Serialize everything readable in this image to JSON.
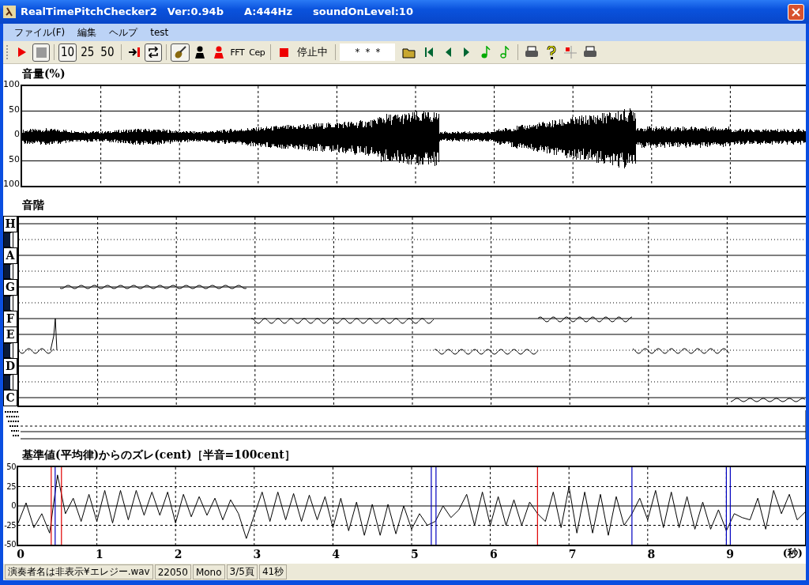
{
  "window": {
    "title": "RealTimePitchChecker2　Ver:0.94b　　A:444Hz　　soundOnLevel:10"
  },
  "menu": [
    "ファイル(F)",
    "編集",
    "ヘルプ",
    "test"
  ],
  "toolbar": {
    "counts": [
      {
        "label": "10",
        "selected": true
      },
      {
        "label": "25",
        "selected": false
      },
      {
        "label": "50",
        "selected": false
      }
    ],
    "loop": {
      "on": true
    },
    "instrument": {
      "on": true
    },
    "analysis": [
      "FFT",
      "Cep"
    ],
    "state": "停止中",
    "display": "＊＊＊"
  },
  "volume": {
    "title": "音量(%)",
    "yticks": [
      "100",
      "50",
      "0",
      "50",
      "100"
    ]
  },
  "scale": {
    "title": "音階",
    "rows": [
      {
        "kind": "natural",
        "label": "H"
      },
      {
        "kind": "sharp"
      },
      {
        "kind": "natural",
        "label": "A"
      },
      {
        "kind": "sharp"
      },
      {
        "kind": "natural",
        "label": "G"
      },
      {
        "kind": "sharp"
      },
      {
        "kind": "natural",
        "label": "F"
      },
      {
        "kind": "natural",
        "label": "E"
      },
      {
        "kind": "sharp"
      },
      {
        "kind": "natural",
        "label": "D"
      },
      {
        "kind": "sharp"
      },
      {
        "kind": "natural",
        "label": "C"
      }
    ]
  },
  "deviation": {
    "chart_data": {
      "type": "line",
      "title": "基準値(平均律)からのズレ(cent)［半音=100cent］",
      "xlabel": "(秒)",
      "x": [
        0,
        0.1,
        0.2,
        0.3,
        0.4,
        0.5,
        0.6,
        0.7,
        0.8,
        0.9,
        1,
        1.1,
        1.2,
        1.3,
        1.4,
        1.5,
        1.6,
        1.7,
        1.8,
        1.9,
        2,
        2.1,
        2.2,
        2.3,
        2.4,
        2.5,
        2.6,
        2.7,
        2.8,
        2.9,
        3,
        3.1,
        3.2,
        3.3,
        3.4,
        3.5,
        3.6,
        3.7,
        3.8,
        3.9,
        4,
        4.1,
        4.2,
        4.3,
        4.4,
        4.5,
        4.6,
        4.7,
        4.8,
        4.9,
        5,
        5.1,
        5.2,
        5.3,
        5.4,
        5.5,
        5.6,
        5.7,
        5.8,
        5.9,
        6,
        6.1,
        6.2,
        6.3,
        6.4,
        6.5,
        6.6,
        6.7,
        6.8,
        6.9,
        7,
        7.1,
        7.2,
        7.3,
        7.4,
        7.5,
        7.6,
        7.7,
        7.8,
        7.9,
        8,
        8.1,
        8.2,
        8.3,
        8.4,
        8.5,
        8.6,
        8.7,
        8.8,
        8.9,
        9,
        9.1,
        9.2,
        9.3,
        9.4,
        9.5,
        9.6,
        9.7,
        9.8,
        9.9,
        10
      ],
      "values": [
        -22,
        4,
        -28,
        -10,
        -35,
        40,
        -10,
        10,
        -20,
        15,
        -20,
        20,
        -22,
        20,
        -18,
        20,
        -12,
        18,
        -12,
        18,
        -22,
        15,
        -14,
        12,
        -12,
        10,
        -18,
        8,
        -10,
        -42,
        -12,
        18,
        -20,
        18,
        -18,
        16,
        -20,
        14,
        -18,
        12,
        -28,
        10,
        -32,
        5,
        -38,
        2,
        -38,
        2,
        -36,
        0,
        -30,
        -10,
        -25,
        -20,
        0,
        -15,
        -5,
        15,
        -25,
        18,
        -25,
        12,
        -25,
        8,
        -25,
        5,
        -10,
        -20,
        18,
        -28,
        25,
        -35,
        18,
        -35,
        15,
        -38,
        12,
        -25,
        -10,
        10,
        -18,
        20,
        -28,
        18,
        -28,
        12,
        -30,
        5,
        -30,
        -5,
        -32,
        -10,
        -15,
        -18,
        10,
        -30,
        20,
        -10,
        15,
        -18,
        -8
      ],
      "grid": true,
      "ref_lines": [
        {
          "axis": "x",
          "value": 0.42,
          "color": "#e00000"
        },
        {
          "axis": "x",
          "value": 0.47,
          "color": "#0000c0"
        },
        {
          "axis": "x",
          "value": 0.55,
          "color": "#e00000"
        },
        {
          "axis": "x",
          "value": 5.25,
          "color": "#0000c0"
        },
        {
          "axis": "x",
          "value": 5.31,
          "color": "#0000c0"
        },
        {
          "axis": "x",
          "value": 6.6,
          "color": "#e00000"
        },
        {
          "axis": "x",
          "value": 7.8,
          "color": "#0000c0"
        },
        {
          "axis": "x",
          "value": 9.0,
          "color": "#0000c0"
        },
        {
          "axis": "x",
          "value": 9.05,
          "color": "#0000c0"
        }
      ],
      "xlim": [
        0,
        10
      ],
      "ylim": [
        -50,
        50
      ],
      "xticks": [
        0,
        1,
        2,
        3,
        4,
        5,
        6,
        7,
        8,
        9
      ],
      "yticks": [
        {
          "value": 50,
          "label": "50"
        },
        {
          "value": 25,
          "label": "25"
        },
        {
          "value": 0,
          "label": "0"
        },
        {
          "value": -25,
          "label": "-25"
        },
        {
          "value": -50,
          "label": "-50"
        }
      ]
    }
  },
  "status_bar": [
    "演奏者名は非表示¥エレジー.wav",
    "22050",
    "Mono",
    "3/5頁",
    "41秒"
  ]
}
